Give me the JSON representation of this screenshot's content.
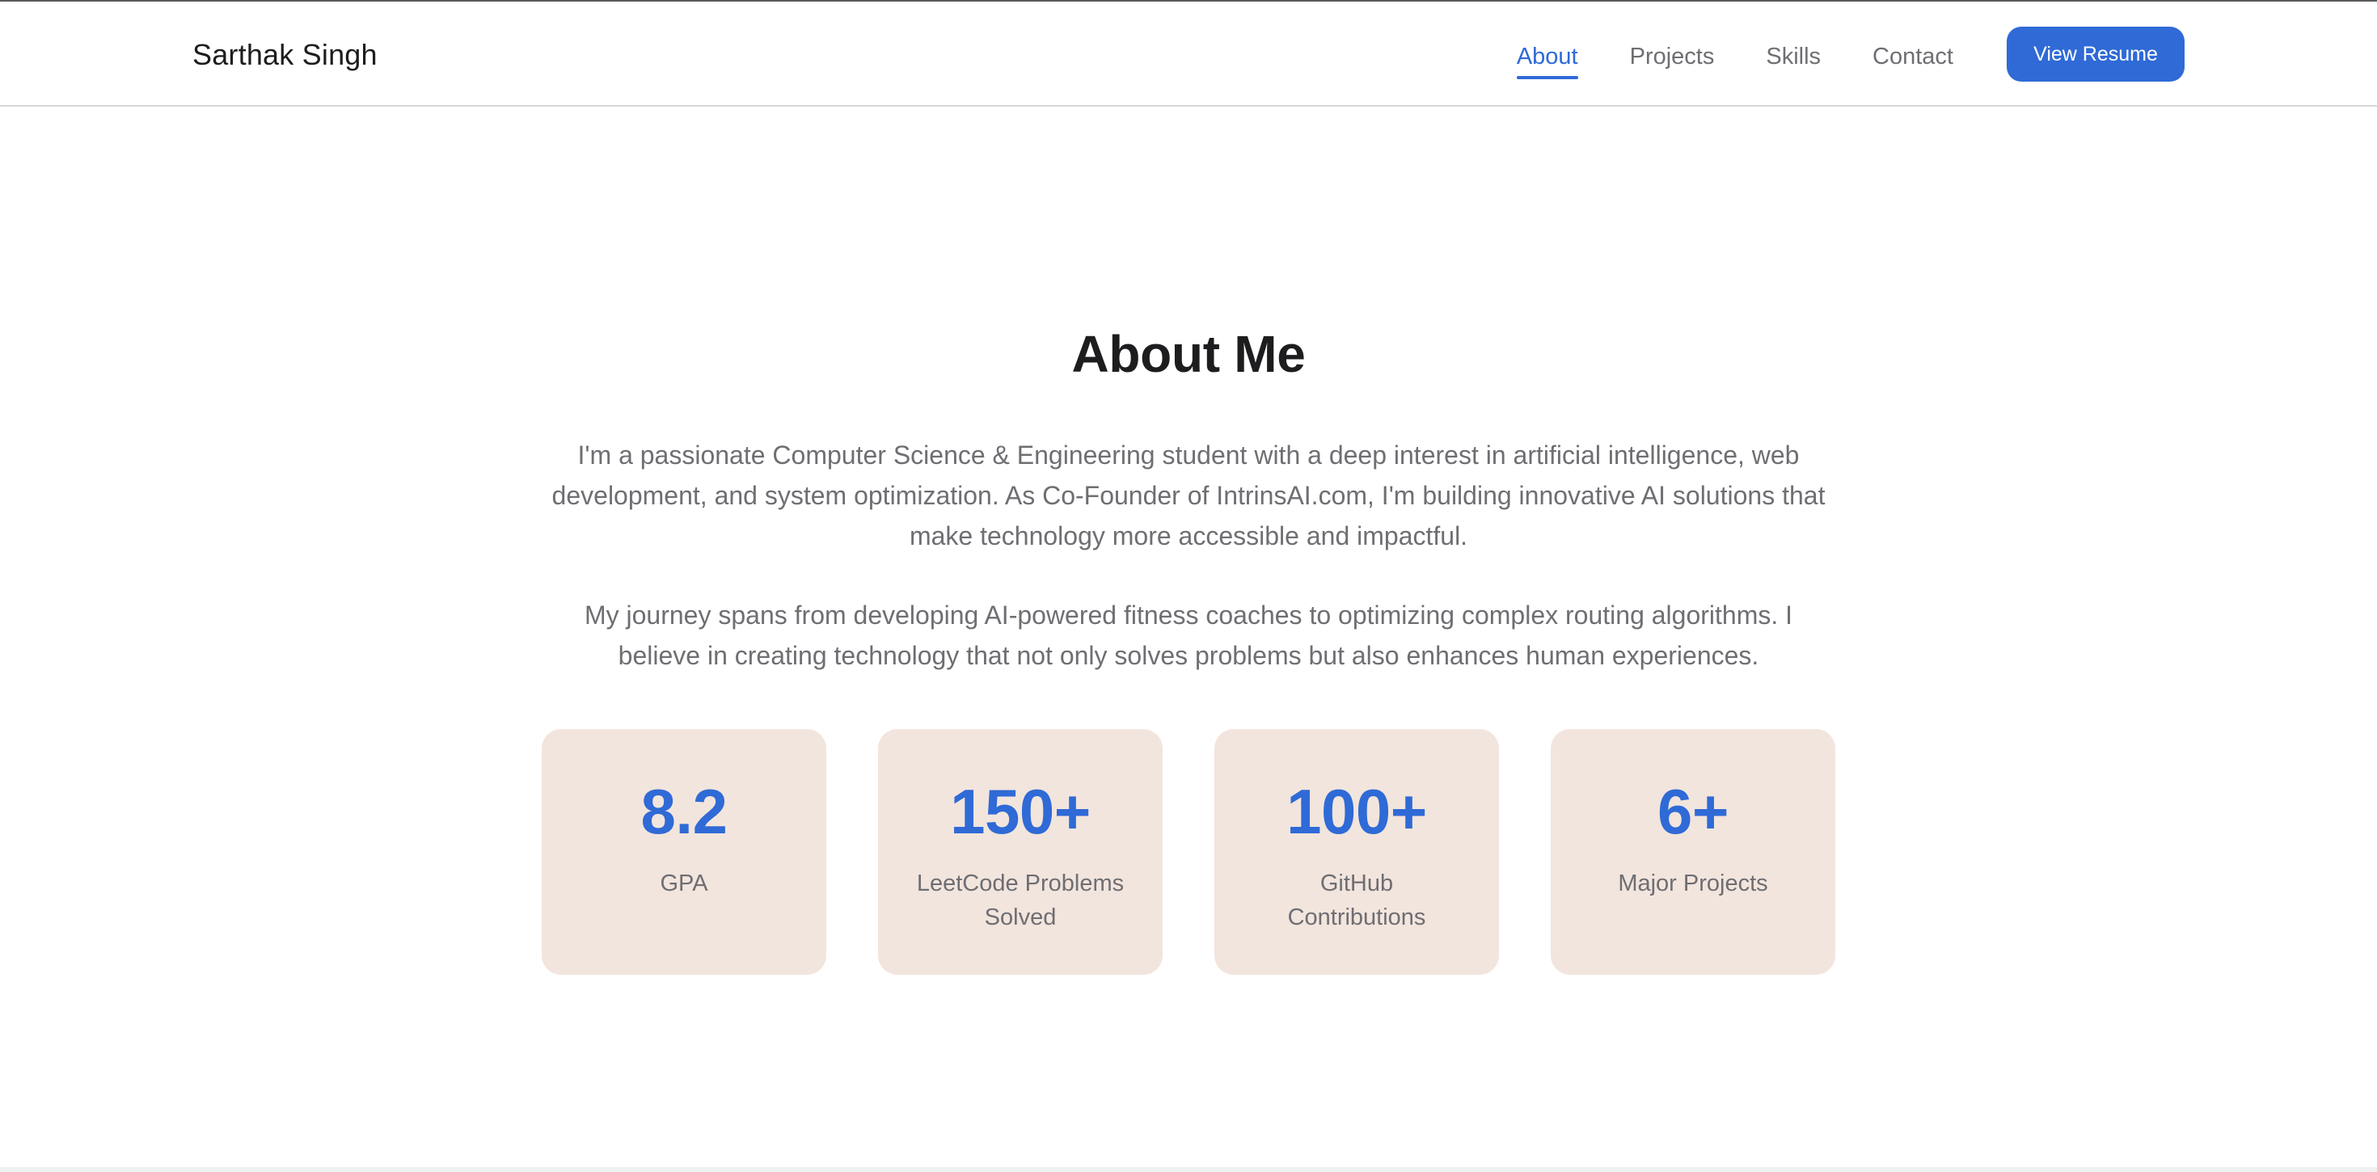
{
  "header": {
    "brand": "Sarthak Singh",
    "nav": {
      "about": "About",
      "projects": "Projects",
      "skills": "Skills",
      "contact": "Contact"
    },
    "resume_button": "View Resume"
  },
  "about": {
    "title": "About Me",
    "paragraphs": [
      "I'm a passionate Computer Science & Engineering student with a deep interest in artificial intelligence, web development, and system optimization. As Co-Founder of IntrinsAI.com, I'm building innovative AI solutions that make technology more accessible and impactful.",
      "My journey spans from developing AI-powered fitness coaches to optimizing complex routing algorithms. I believe in creating technology that not only solves problems but also enhances human experiences."
    ],
    "stats": [
      {
        "value": "8.2",
        "label": "GPA"
      },
      {
        "value": "150+",
        "label": "LeetCode Problems Solved"
      },
      {
        "value": "100+",
        "label": "GitHub Contributions"
      },
      {
        "value": "6+",
        "label": "Major Projects"
      }
    ]
  },
  "colors": {
    "accent": "#2f6ad6",
    "card_background": "#f2e5dd",
    "text_primary": "#1d1d1f",
    "text_secondary": "#6e6e73"
  }
}
